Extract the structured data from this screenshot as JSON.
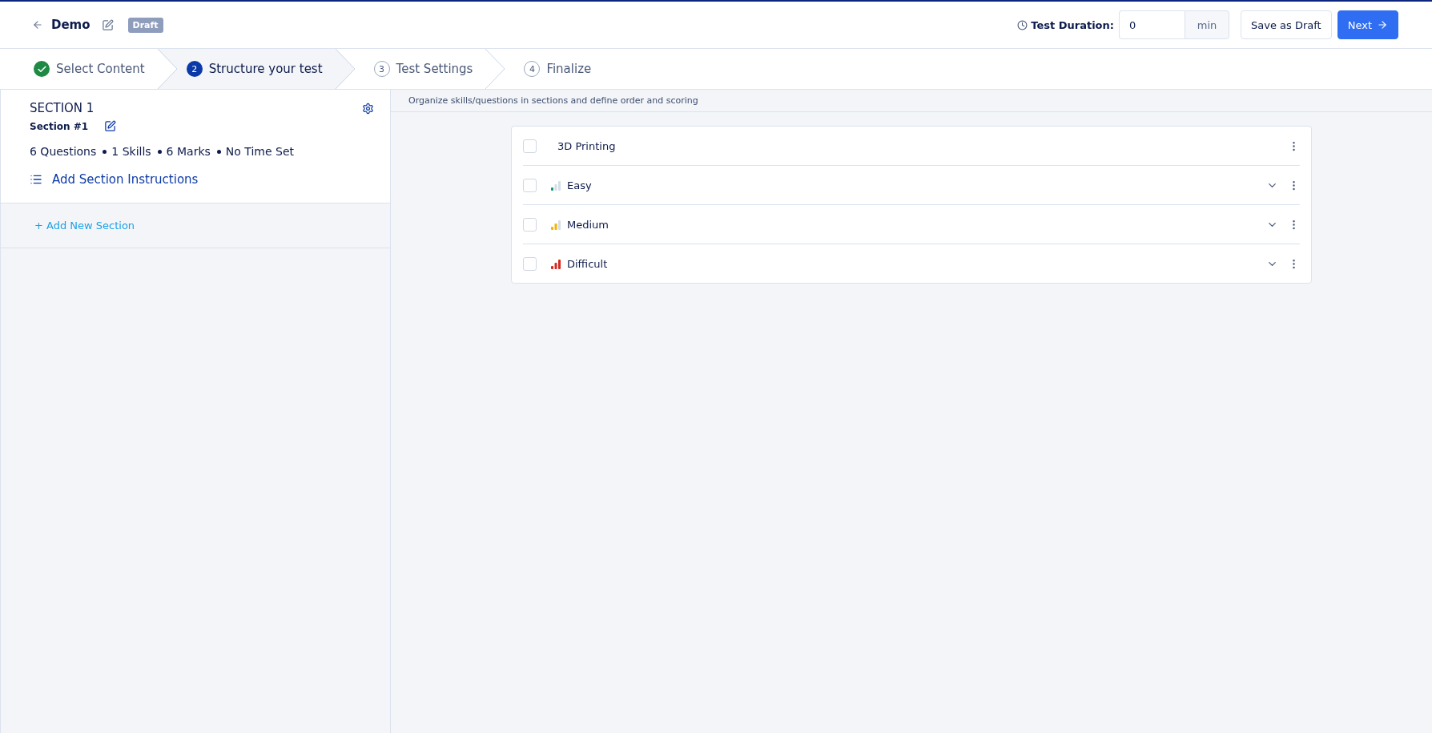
{
  "header": {
    "title": "Demo",
    "badge": "Draft",
    "duration_label": "Test Duration:",
    "duration_value": "0",
    "duration_unit": "min",
    "buttons": [
      {
        "label": "Save as Draft",
        "kind": "secondary"
      },
      {
        "label": "Next",
        "kind": "primary"
      }
    ]
  },
  "steps": [
    {
      "kind": "done",
      "label": "Select Content",
      "selected": false
    },
    {
      "kind": "current",
      "number": "2",
      "label": "Structure your test",
      "selected": true
    },
    {
      "kind": "todo",
      "number": "3",
      "label": "Test Settings",
      "selected": false
    },
    {
      "kind": "todo",
      "number": "4",
      "label": "Finalize",
      "selected": false
    }
  ],
  "sections": [
    {
      "title": "SECTION 1",
      "name": "Section #1",
      "stats": [
        "6 Questions",
        "1 Skills",
        "6 Marks",
        "No Time Set"
      ],
      "instructions_link": "Add Section Instructions",
      "selected": true
    }
  ],
  "add_section": "+ Add New Section",
  "hint": "Organize skills/questions in sections and define order and scoring",
  "items": [
    {
      "kind": "skill",
      "label": "3D Printing",
      "checked": false
    },
    {
      "kind": "level",
      "label": "Easy",
      "checked": false,
      "level": 0.33,
      "color": "#14967a",
      "expanded": false
    },
    {
      "kind": "level",
      "label": "Medium",
      "checked": false,
      "level": 0.67,
      "color": "#f5b400",
      "expanded": false
    },
    {
      "kind": "level",
      "label": "Difficult",
      "checked": false,
      "level": 1,
      "color": "#d42a20",
      "expanded": false
    }
  ]
}
